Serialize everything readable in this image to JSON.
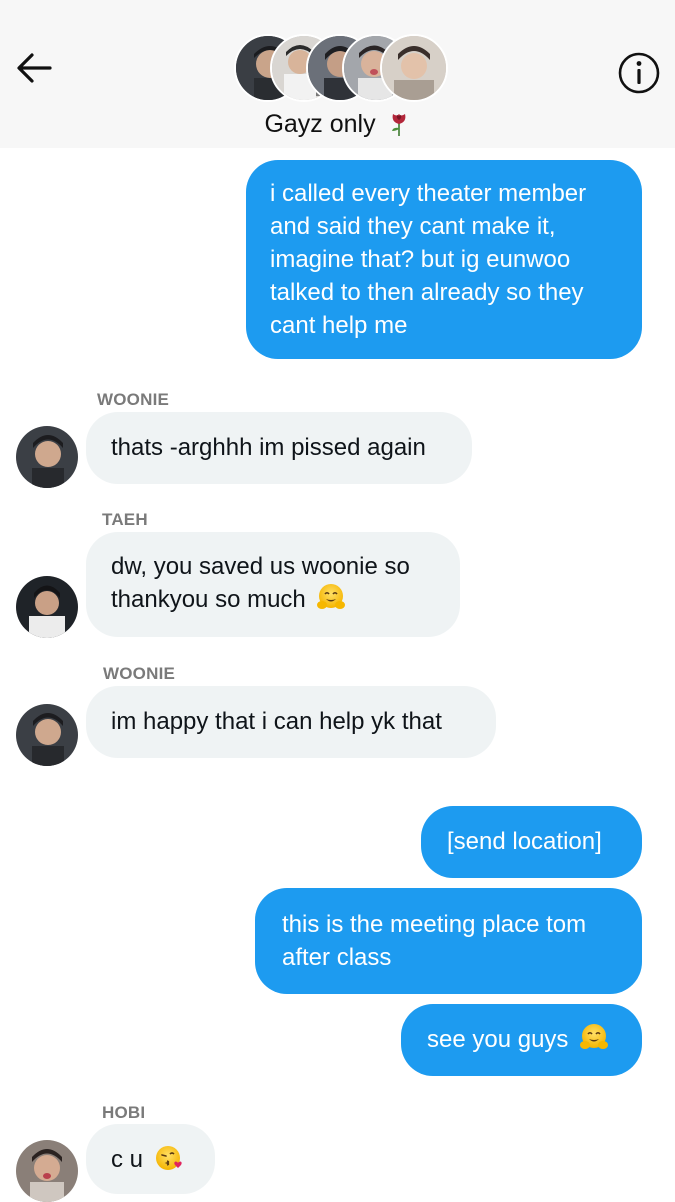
{
  "header": {
    "title": "Gayz only",
    "title_emoji": "wilted-rose",
    "back_icon": "arrow-left-icon",
    "info_icon": "info-icon",
    "participant_avatars": [
      "avatar-1",
      "avatar-2",
      "avatar-3",
      "avatar-4",
      "avatar-5"
    ]
  },
  "messages": [
    {
      "side": "out",
      "text": "i called every theater member and said they cant make it, imagine that? but ig eunwoo talked to then already so they cant help me"
    },
    {
      "side": "in",
      "sender": "WOONIE",
      "text": "thats -arghhh im pissed again"
    },
    {
      "side": "in",
      "sender": "TAEH",
      "text": "dw, you saved us woonie so thankyou so much",
      "emoji": "hugging-face"
    },
    {
      "side": "in",
      "sender": "WOONIE",
      "text": "im happy that i can help yk that"
    },
    {
      "side": "out",
      "text": "[send location]"
    },
    {
      "side": "out",
      "text": "this is the meeting place tom after class"
    },
    {
      "side": "out",
      "text": "see you guys",
      "emoji": "hugging-face"
    },
    {
      "side": "in",
      "sender": "HOBI",
      "text": "c u",
      "emoji": "face-blowing-kiss"
    }
  ],
  "colors": {
    "outgoing_bubble": "#1d9bf0",
    "incoming_bubble": "#eff3f4",
    "header_bg": "#f7f7f7",
    "sender_label": "#7a7a7a"
  }
}
